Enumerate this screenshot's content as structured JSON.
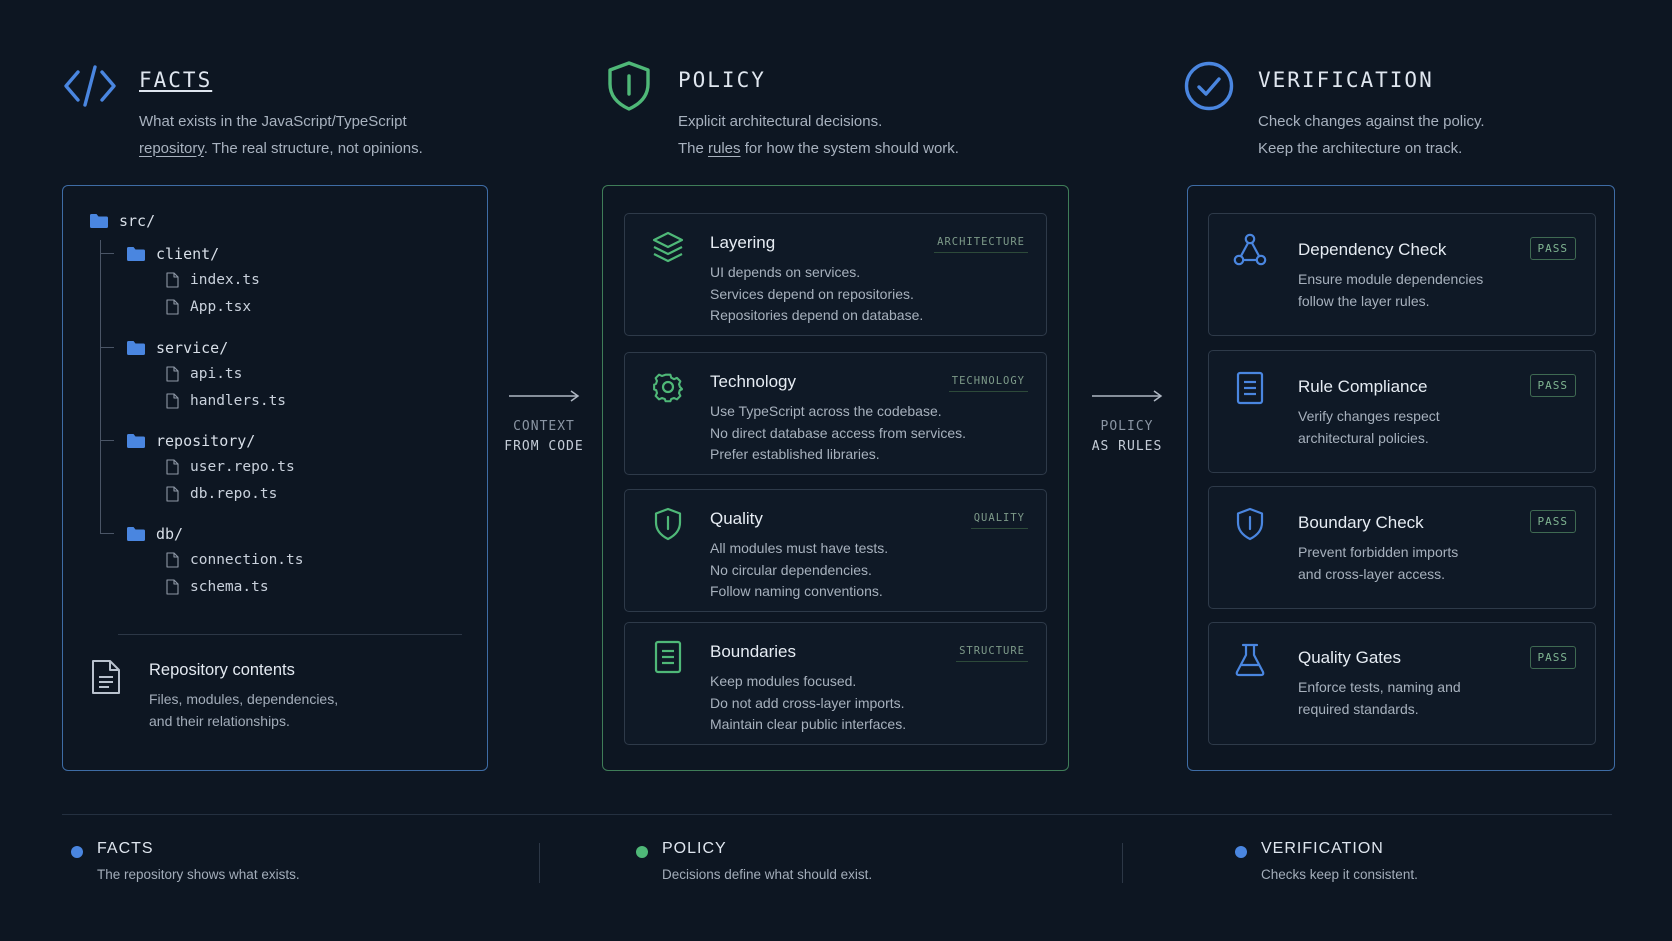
{
  "columns": {
    "facts": {
      "title": "FACTS",
      "desc_line1": "What exists in the JavaScript/TypeScript",
      "desc_line2_underlined": "repository",
      "desc_line2_rest": ". The real structure, not opinions."
    },
    "policy": {
      "title": "POLICY",
      "desc_line1": "Explicit architectural decisions.",
      "desc_line2_prefix": "The ",
      "desc_line2_underlined": "rules",
      "desc_line2_rest": " for how the system should work."
    },
    "verification": {
      "title": "VERIFICATION",
      "desc_line1": "Check changes against the policy.",
      "desc_line2": "Keep the architecture on track."
    }
  },
  "tree": {
    "root": "src/",
    "folders": [
      {
        "name": "client/",
        "files": [
          "index.ts",
          "App.tsx"
        ]
      },
      {
        "name": "service/",
        "files": [
          "api.ts",
          "handlers.ts"
        ]
      },
      {
        "name": "repository/",
        "files": [
          "user.repo.ts",
          "db.repo.ts"
        ]
      },
      {
        "name": "db/",
        "files": [
          "connection.ts",
          "schema.ts"
        ]
      }
    ]
  },
  "repo_summary": {
    "title": "Repository contents",
    "desc_line1": "Files, modules, dependencies,",
    "desc_line2": "and their relationships."
  },
  "arrows": {
    "first": {
      "line1": "CONTEXT",
      "line2": "FROM CODE"
    },
    "second": {
      "line1": "POLICY",
      "line2": "AS RULES"
    }
  },
  "policy_cards": [
    {
      "title": "Layering",
      "tag": "ARCHITECTURE",
      "icon": "layers-icon",
      "lines": [
        "UI depends on services.",
        "Services depend on repositories.",
        "Repositories depend on database."
      ]
    },
    {
      "title": "Technology",
      "tag": "TECHNOLOGY",
      "icon": "gear-icon",
      "lines": [
        "Use TypeScript across the codebase.",
        "No direct database access from services.",
        "Prefer established libraries."
      ]
    },
    {
      "title": "Quality",
      "tag": "QUALITY",
      "icon": "shield-icon",
      "lines": [
        "All modules must have tests.",
        "No circular dependencies.",
        "Follow naming conventions."
      ]
    },
    {
      "title": "Boundaries",
      "tag": "STRUCTURE",
      "icon": "document-icon",
      "lines": [
        "Keep modules focused.",
        "Do not add cross-layer imports.",
        "Maintain clear public interfaces."
      ]
    }
  ],
  "verification_cards": [
    {
      "title": "Dependency Check",
      "status": "PASS",
      "icon": "dependency-graph-icon",
      "lines": [
        "Ensure module dependencies",
        "follow the layer rules."
      ]
    },
    {
      "title": "Rule Compliance",
      "status": "PASS",
      "icon": "document-icon",
      "lines": [
        "Verify changes respect",
        "architectural policies."
      ]
    },
    {
      "title": "Boundary Check",
      "status": "PASS",
      "icon": "shield-icon",
      "lines": [
        "Prevent forbidden imports",
        "and cross-layer access."
      ]
    },
    {
      "title": "Quality Gates",
      "status": "PASS",
      "icon": "flask-icon",
      "lines": [
        "Enforce tests, naming and",
        "required standards."
      ]
    }
  ],
  "legend": [
    {
      "title": "FACTS",
      "desc": "The repository shows what exists.",
      "color": "#4a86e0"
    },
    {
      "title": "POLICY",
      "desc": "Decisions define what should exist.",
      "color": "#4fb878"
    },
    {
      "title": "VERIFICATION",
      "desc": "Checks keep it consistent.",
      "color": "#4a86e0"
    }
  ],
  "colors": {
    "background": "#0d1622",
    "facts_accent": "#4a86e0",
    "policy_accent": "#4fb878",
    "verification_accent": "#4a86e0"
  }
}
